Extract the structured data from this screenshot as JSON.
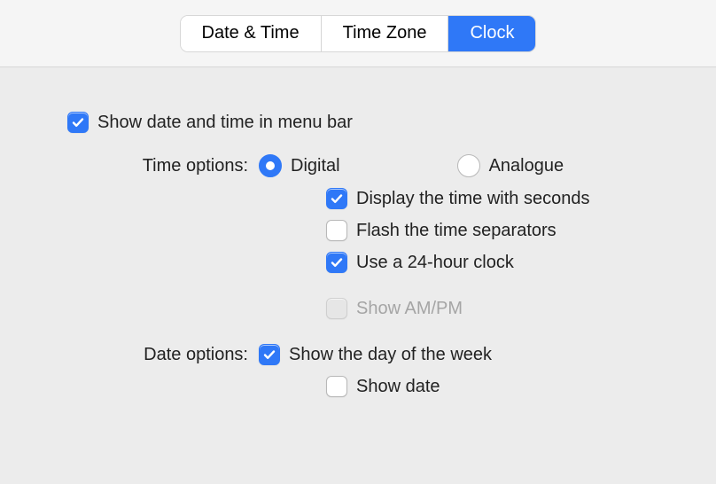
{
  "tabs": {
    "date_time": "Date & Time",
    "time_zone": "Time Zone",
    "clock": "Clock"
  },
  "main_checkbox": {
    "label": "Show date and time in menu bar",
    "checked": true
  },
  "time_options": {
    "label": "Time options:",
    "digital": {
      "label": "Digital",
      "selected": true
    },
    "analogue": {
      "label": "Analogue",
      "selected": false
    },
    "display_seconds": {
      "label": "Display the time with seconds",
      "checked": true
    },
    "flash_separators": {
      "label": "Flash the time separators",
      "checked": false
    },
    "use_24h": {
      "label": "Use a 24-hour clock",
      "checked": true
    },
    "show_ampm": {
      "label": "Show AM/PM",
      "checked": false,
      "disabled": true
    }
  },
  "date_options": {
    "label": "Date options:",
    "show_day_of_week": {
      "label": "Show the day of the week",
      "checked": true
    },
    "show_date": {
      "label": "Show date",
      "checked": false
    }
  }
}
